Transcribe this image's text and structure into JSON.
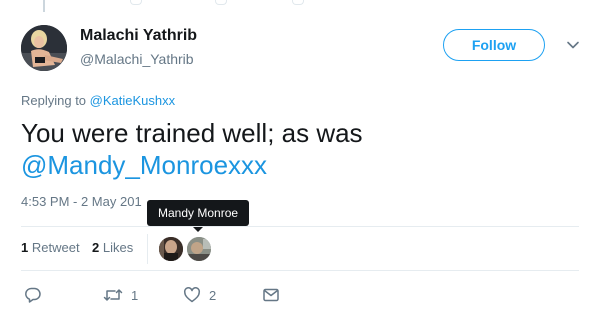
{
  "author": {
    "display_name": "Malachi Yathrib",
    "handle": "@Malachi_Yathrib"
  },
  "follow_button": {
    "label": "Follow"
  },
  "replying": {
    "prefix": "Replying to ",
    "handle": "@KatieKushxx"
  },
  "tweet": {
    "text": "You were trained well; as was",
    "mention": "@Mandy_Monroexxx"
  },
  "timestamp": "4:53 PM - 2 May 201",
  "tooltip": {
    "text": "Mandy Monroe"
  },
  "stats": {
    "retweets_count": "1",
    "retweets_label": "Retweet",
    "likes_count": "2",
    "likes_label": "Likes"
  },
  "actions": {
    "reply_icon": "reply-icon",
    "retweet_icon": "retweet-icon",
    "retweet_count": "1",
    "like_icon": "heart-icon",
    "like_count": "2",
    "dm_icon": "envelope-icon"
  },
  "colors": {
    "accent": "#1da1f2",
    "link": "#1b95e0",
    "muted": "#657786",
    "text": "#14171a"
  }
}
